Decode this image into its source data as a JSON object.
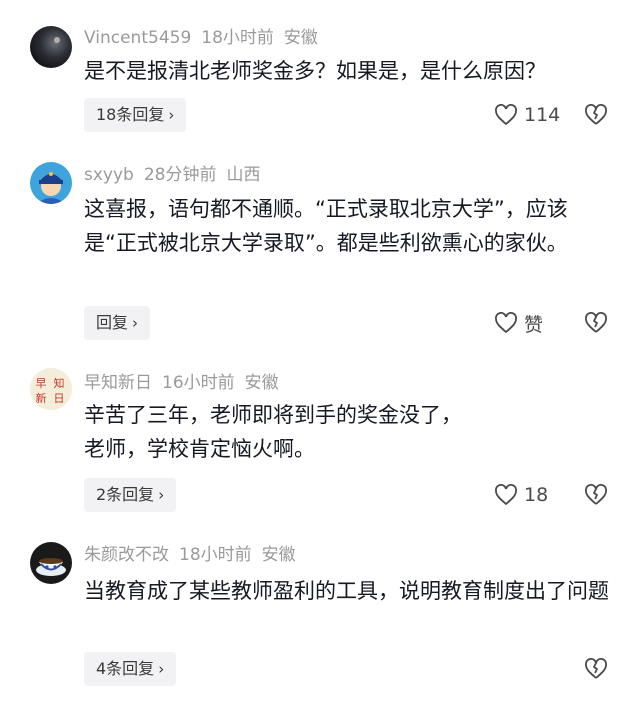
{
  "comments": [
    {
      "username": "Vincent5459",
      "time": "18小时前",
      "location": "安徽",
      "text": "是不是报清北老师奖金多？如果是，是什么原因？",
      "reply_label": "18条回复",
      "like_count": "114"
    },
    {
      "username": "sxyyb",
      "time": "28分钟前",
      "location": "山西",
      "text": "这喜报，语句都不通顺。“正式录取北京大学”，应该是“正式被北京大学录取”。都是些利欲熏心的家伙。",
      "reply_label": "回复",
      "like_count": "赞"
    },
    {
      "username": "早知新日",
      "time": "16小时前",
      "location": "安徽",
      "text_lines": [
        "辛苦了三年，老师即将到手的奖金没了，",
        "老师，学校肯定恼火啊。"
      ],
      "reply_label": "2条回复",
      "like_count": "18",
      "avatar_chars": [
        "早",
        "知",
        "新",
        "日"
      ]
    },
    {
      "username": "朱颜改不改",
      "time": "18小时前",
      "location": "安徽",
      "text": "当教育成了某些教师盈利的工具，说明教育制度出了问题",
      "reply_label": "4条回复"
    }
  ],
  "icons": {
    "like": "heart-outline-icon",
    "dislike": "broken-heart-icon",
    "chevron": "chevron-right-icon"
  }
}
